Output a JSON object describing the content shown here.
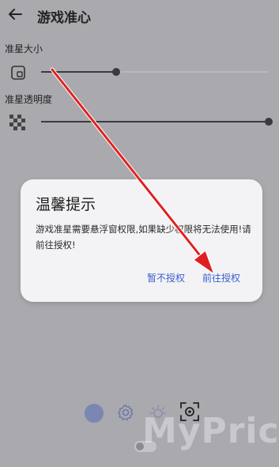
{
  "header": {
    "title": "游戏准心",
    "back_icon": "arrow-left-icon"
  },
  "settings": {
    "size_label": "准星大小",
    "size_level": 0.33,
    "alpha_label": "准星透明度",
    "alpha_level": 1.0
  },
  "dialog": {
    "title": "温馨提示",
    "message": "游戏准星需要悬浮窗权限,如果缺少权限将无法使用!请前往授权!",
    "deny_label": "暂不授权",
    "go_label": "前往授权"
  },
  "bottom_bar": {
    "icons": [
      "color-dot-icon",
      "gear-icon",
      "brightness-icon",
      "crosshair-icon"
    ],
    "accent_color": "#7b87b3"
  },
  "watermark": {
    "text": "MyPrice"
  },
  "colors": {
    "background": "#a9a9ae",
    "dialog_bg": "#f3f3f5",
    "link": "#3b5ccc",
    "arrow": "#e02020"
  }
}
